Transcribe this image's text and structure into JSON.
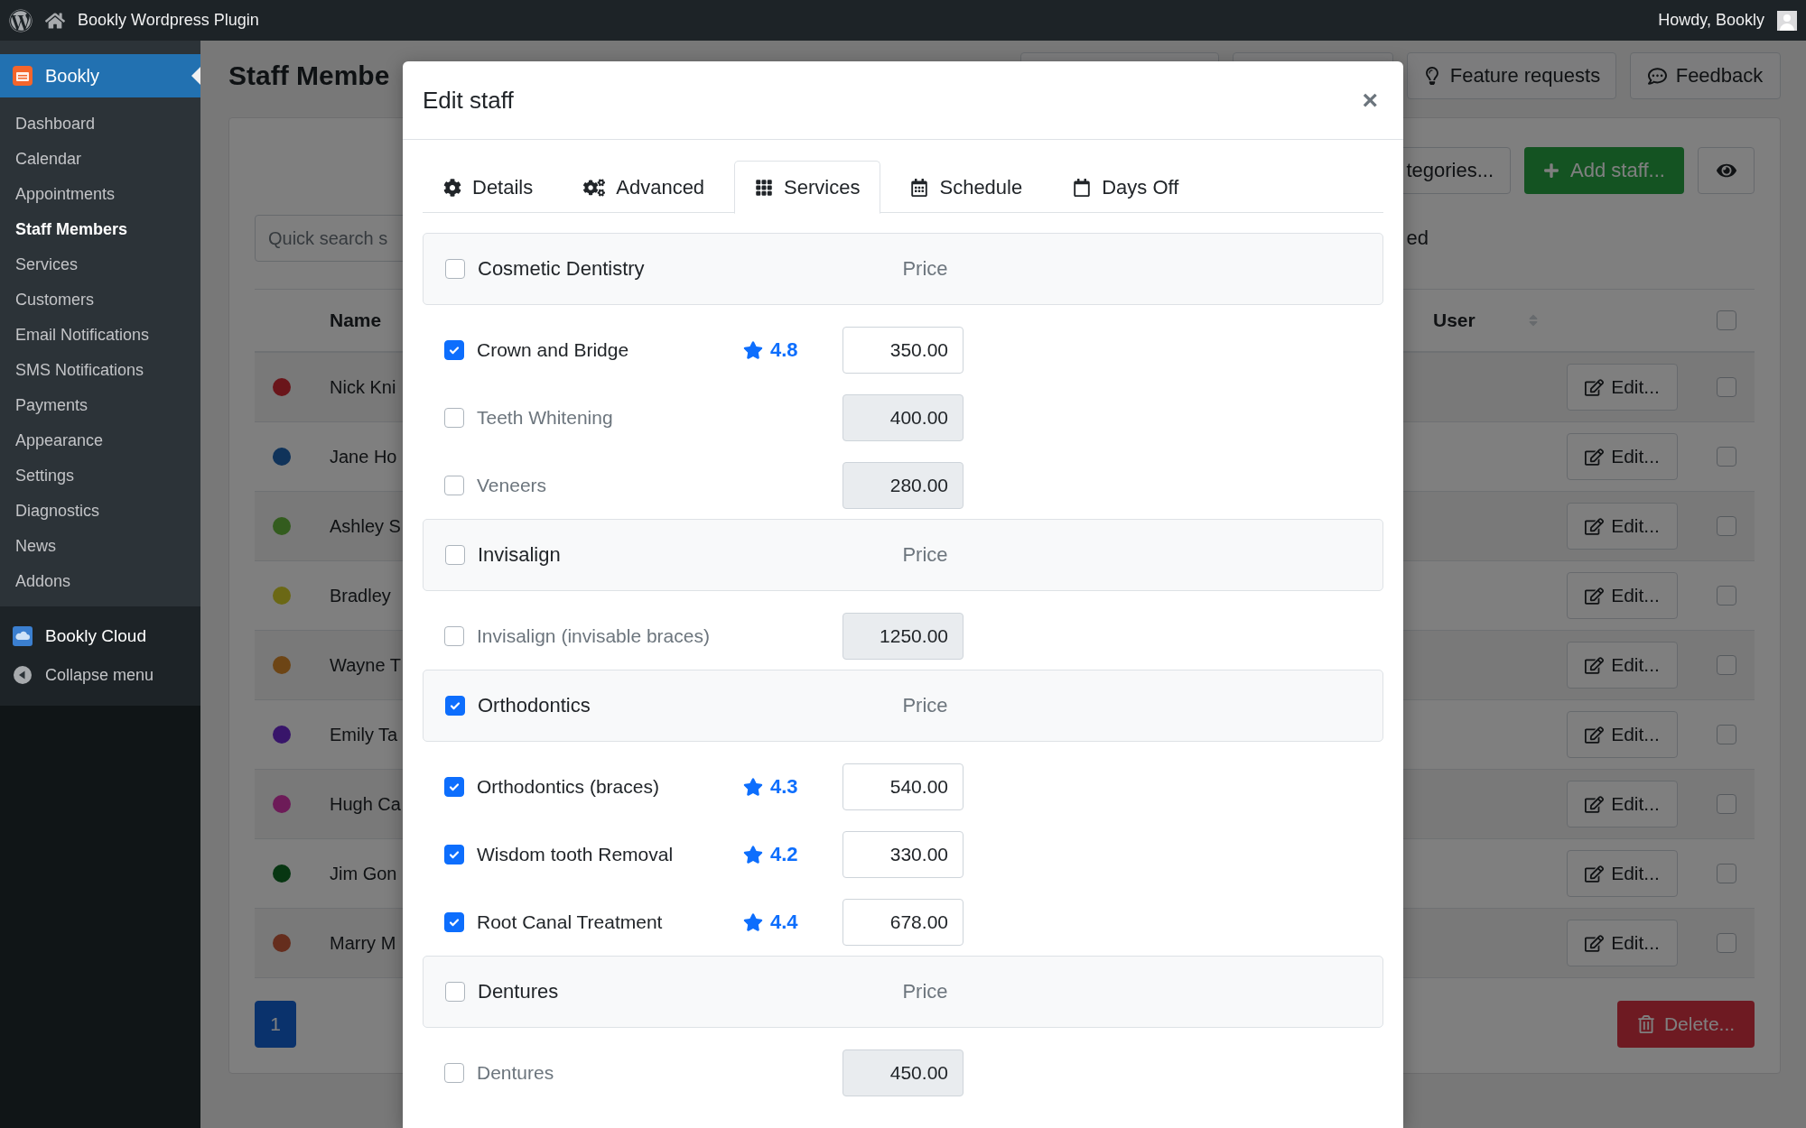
{
  "top_bar": {
    "site_name": "Bookly Wordpress Plugin",
    "greeting": "Howdy, Bookly"
  },
  "sidebar": {
    "plugin": {
      "label": "Bookly",
      "selected": true
    },
    "items": [
      {
        "label": "Dashboard",
        "selected": false
      },
      {
        "label": "Calendar",
        "selected": false
      },
      {
        "label": "Appointments",
        "selected": false
      },
      {
        "label": "Staff Members",
        "selected": true
      },
      {
        "label": "Services",
        "selected": false
      },
      {
        "label": "Customers",
        "selected": false
      },
      {
        "label": "Email Notifications",
        "selected": false
      },
      {
        "label": "SMS Notifications",
        "selected": false
      },
      {
        "label": "Payments",
        "selected": false
      },
      {
        "label": "Appearance",
        "selected": false
      },
      {
        "label": "Settings",
        "selected": false
      },
      {
        "label": "Diagnostics",
        "selected": false
      },
      {
        "label": "News",
        "selected": false
      },
      {
        "label": "Addons",
        "selected": false
      }
    ],
    "cloud": "Bookly Cloud",
    "collapse": "Collapse menu"
  },
  "page": {
    "title": "Staff Membe",
    "header_buttons": [
      {
        "kind": "blank"
      },
      {
        "kind": "blank"
      },
      {
        "kind": "idea",
        "label": "Feature requests"
      },
      {
        "kind": "chat",
        "label": "Feedback"
      }
    ],
    "categories_button": "tegories...",
    "add_button": "Add staff...",
    "archived_text": "ed",
    "search": {
      "placeholder": "Quick search s"
    },
    "table": {
      "columns": [
        "Name",
        "User"
      ],
      "select_all": {
        "checked": false
      },
      "rows": [
        {
          "color": "#6a151a",
          "name": "Nick Kni",
          "action": "Edit...",
          "checked": false
        },
        {
          "color": "#10335a",
          "name": "Jane Ho",
          "action": "Edit...",
          "checked": false
        },
        {
          "color": "#335c1e",
          "name": "Ashley S",
          "action": "Edit...",
          "checked": false
        },
        {
          "color": "#6b6815",
          "name": "Bradley",
          "action": "Edit...",
          "checked": false
        },
        {
          "color": "#6d4515",
          "name": "Wayne T",
          "action": "Edit...",
          "checked": false
        },
        {
          "color": "#38156a",
          "name": "Emily Ta",
          "action": "Edit...",
          "checked": false
        },
        {
          "color": "#6d1b58",
          "name": "Hugh Ca",
          "action": "Edit...",
          "checked": false
        },
        {
          "color": "#073612",
          "name": "Jim Gon",
          "action": "Edit...",
          "checked": false
        },
        {
          "color": "#652d1d",
          "name": "Marry M",
          "action": "Edit...",
          "checked": false
        }
      ]
    },
    "pagination": [
      {
        "label": "1",
        "selected": true
      }
    ],
    "delete_button": "Delete..."
  },
  "modal": {
    "title": "Edit staff",
    "close": "×",
    "tabs": [
      {
        "kind": "details",
        "label": "Details",
        "selected": false
      },
      {
        "kind": "advanced",
        "label": "Advanced",
        "selected": false
      },
      {
        "kind": "services",
        "label": "Services",
        "selected": true
      },
      {
        "kind": "schedule",
        "label": "Schedule",
        "selected": false
      },
      {
        "kind": "daysoff",
        "label": "Days Off",
        "selected": false
      }
    ],
    "groups": [
      {
        "name": "Cosmetic Dentistry",
        "checked": false,
        "price_header": "Price",
        "services": [
          {
            "name": "Crown and Bridge",
            "checked": true,
            "rating": "4.8",
            "price": "350.00"
          },
          {
            "name": "Teeth Whitening",
            "checked": false,
            "price": "400.00"
          },
          {
            "name": "Veneers",
            "checked": false,
            "price": "280.00"
          }
        ]
      },
      {
        "name": "Invisalign",
        "checked": false,
        "price_header": "Price",
        "services": [
          {
            "name": "Invisalign (invisable braces)",
            "checked": false,
            "price": "1250.00"
          }
        ]
      },
      {
        "name": "Orthodontics",
        "checked": true,
        "price_header": "Price",
        "services": [
          {
            "name": "Orthodontics (braces)",
            "checked": true,
            "rating": "4.3",
            "price": "540.00"
          },
          {
            "name": "Wisdom tooth Removal",
            "checked": true,
            "rating": "4.2",
            "price": "330.00"
          },
          {
            "name": "Root Canal Treatment",
            "checked": true,
            "rating": "4.4",
            "price": "678.00"
          }
        ]
      },
      {
        "name": "Dentures",
        "checked": false,
        "price_header": "Price",
        "services": [
          {
            "name": "Dentures",
            "checked": false,
            "price": "450.00"
          }
        ]
      }
    ]
  }
}
